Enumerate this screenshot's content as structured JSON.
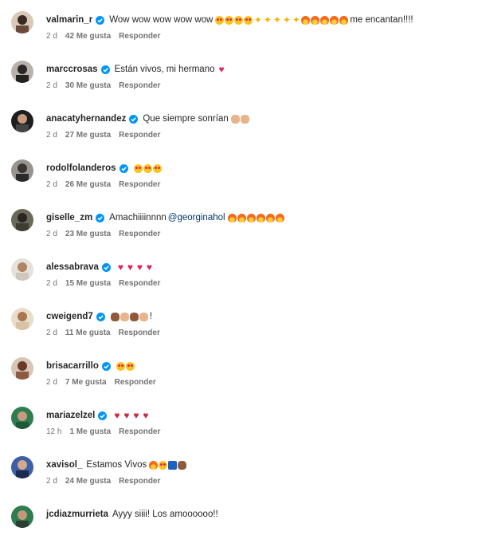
{
  "comments": [
    {
      "username": "valmarin_r",
      "verified": true,
      "text": "Wow wow wow wow wow",
      "emojis": [
        "heart-eyes",
        "heart-eyes",
        "heart-eyes",
        "heart-eyes",
        "sparkle",
        "sparkle",
        "sparkle",
        "sparkle",
        "sparkle",
        "fire",
        "fire",
        "fire",
        "fire",
        "fire"
      ],
      "tail": "me encantan!!!!",
      "time": "2 d",
      "likes": "42 Me gusta",
      "reply": "Responder"
    },
    {
      "username": "marccrosas",
      "verified": true,
      "text": "Están vivos, mi hermano",
      "emojis": [
        "heart"
      ],
      "tail": "",
      "time": "2 d",
      "likes": "30 Me gusta",
      "reply": "Responder"
    },
    {
      "username": "anacatyhernandez",
      "verified": true,
      "text": "Que siempre sonrían",
      "emojis": [
        "clap",
        "clap"
      ],
      "tail": "",
      "time": "2 d",
      "likes": "27 Me gusta",
      "reply": "Responder"
    },
    {
      "username": "rodolfolanderos",
      "verified": true,
      "text": "",
      "emojis": [
        "heart-eyes",
        "heart-eyes",
        "heart-eyes"
      ],
      "tail": "",
      "time": "2 d",
      "likes": "26 Me gusta",
      "reply": "Responder"
    },
    {
      "username": "giselle_zm",
      "verified": true,
      "text": "Amachiiiinnnn",
      "mention": "@georginahol",
      "emojis": [
        "fire",
        "fire",
        "fire",
        "fire",
        "fire",
        "fire"
      ],
      "tail": "",
      "time": "2 d",
      "likes": "23 Me gusta",
      "reply": "Responder"
    },
    {
      "username": "alessabrava",
      "verified": true,
      "text": "",
      "emojis": [
        "heart",
        "heart",
        "heart",
        "heart"
      ],
      "tail": "",
      "time": "2 d",
      "likes": "15 Me gusta",
      "reply": "Responder"
    },
    {
      "username": "cweigend7",
      "verified": true,
      "text": "",
      "emojis": [
        "clap-dark",
        "clap",
        "clap-dark",
        "clap"
      ],
      "tail": "!",
      "time": "2 d",
      "likes": "11 Me gusta",
      "reply": "Responder"
    },
    {
      "username": "brisacarrillo",
      "verified": true,
      "text": "",
      "emojis": [
        "heart-eyes",
        "heart-eyes"
      ],
      "tail": "",
      "time": "2 d",
      "likes": "7 Me gusta",
      "reply": "Responder"
    },
    {
      "username": "mariazelzel",
      "verified": true,
      "text": "",
      "emojis": [
        "broken",
        "broken",
        "broken",
        "broken"
      ],
      "tail": "",
      "time": "12 h",
      "likes": "1 Me gusta",
      "reply": "Responder"
    },
    {
      "username": "xavisol_",
      "verified": false,
      "text": "Estamos Vivos",
      "emojis": [
        "fire",
        "heart-eyes",
        "flag",
        "people"
      ],
      "tail": "",
      "time": "2 d",
      "likes": "24 Me gusta",
      "reply": "Responder"
    },
    {
      "username": "jcdiazmurrieta",
      "verified": false,
      "text": "Ayyy siiii! Los amoooooo!!",
      "emojis": [],
      "tail": "",
      "time": "",
      "likes": "",
      "reply": ""
    }
  ],
  "colors": {
    "verified": "#0095f6",
    "username": "#262626",
    "meta": "#737373",
    "mention": "#00376b"
  }
}
